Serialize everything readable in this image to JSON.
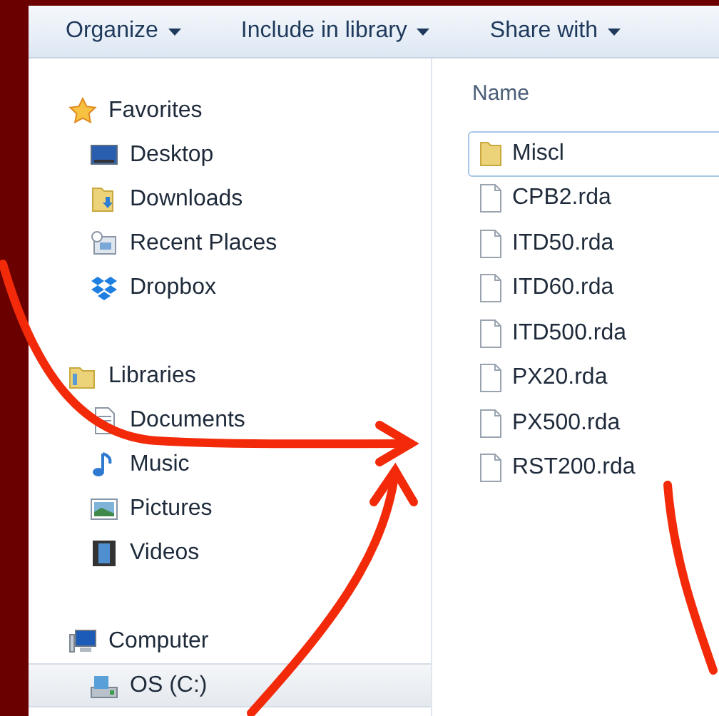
{
  "toolbar": [
    {
      "label": "Organize"
    },
    {
      "label": "Include in library"
    },
    {
      "label": "Share with"
    }
  ],
  "navigation": [
    {
      "label": "Favorites",
      "kind": "star",
      "selected": false,
      "children": [
        {
          "label": "Desktop",
          "kind": "desktop",
          "selected": false
        },
        {
          "label": "Downloads",
          "kind": "downloads",
          "selected": false
        },
        {
          "label": "Recent Places",
          "kind": "recent",
          "selected": false
        },
        {
          "label": "Dropbox",
          "kind": "dropbox",
          "selected": false
        }
      ]
    },
    {
      "label": "Libraries",
      "kind": "library",
      "selected": false,
      "children": [
        {
          "label": "Documents",
          "kind": "document",
          "selected": false
        },
        {
          "label": "Music",
          "kind": "music",
          "selected": false
        },
        {
          "label": "Pictures",
          "kind": "pictures",
          "selected": false
        },
        {
          "label": "Videos",
          "kind": "videos",
          "selected": false
        }
      ]
    },
    {
      "label": "Computer",
      "kind": "computer",
      "selected": false,
      "children": [
        {
          "label": "OS (C:)",
          "kind": "drive",
          "selected": true
        }
      ]
    }
  ],
  "file_list": {
    "column": "Name",
    "items": [
      {
        "name": "Miscl",
        "kind": "folder",
        "focused": true
      },
      {
        "name": "CPB2.rda",
        "kind": "file",
        "focused": false
      },
      {
        "name": "ITD50.rda",
        "kind": "file",
        "focused": false
      },
      {
        "name": "ITD60.rda",
        "kind": "file",
        "focused": false
      },
      {
        "name": "ITD500.rda",
        "kind": "file",
        "focused": false
      },
      {
        "name": "PX20.rda",
        "kind": "file",
        "focused": false
      },
      {
        "name": "PX500.rda",
        "kind": "file",
        "focused": false
      },
      {
        "name": "RST200.rda",
        "kind": "file",
        "focused": false
      }
    ]
  }
}
